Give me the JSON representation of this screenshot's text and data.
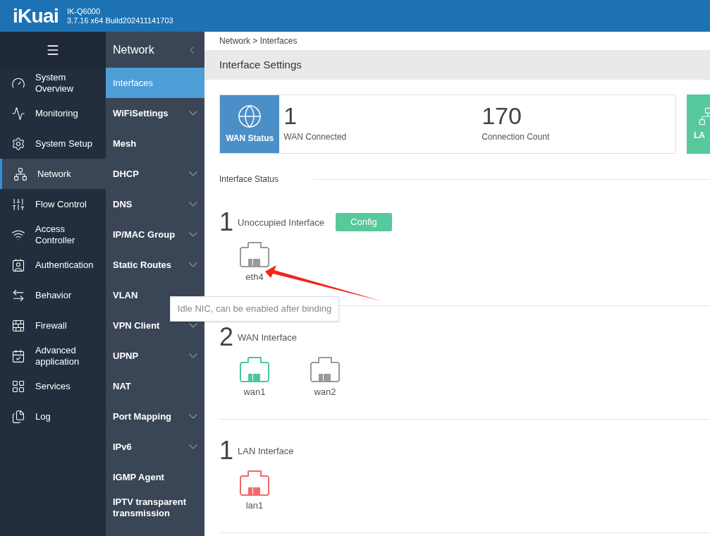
{
  "header": {
    "logo": "iKuai",
    "model": "IK-Q6000",
    "build": "3.7.16 x64 Build202411141703"
  },
  "main_nav": [
    {
      "label": "System Overview",
      "selected": false
    },
    {
      "label": "Monitoring",
      "selected": false
    },
    {
      "label": "System Setup",
      "selected": false
    },
    {
      "label": "Network",
      "selected": true
    },
    {
      "label": "Flow Control",
      "selected": false
    },
    {
      "label": "Access Controller",
      "selected": false
    },
    {
      "label": "Authentication",
      "selected": false
    },
    {
      "label": "Behavior",
      "selected": false
    },
    {
      "label": "Firewall",
      "selected": false
    },
    {
      "label": "Advanced application",
      "selected": false
    },
    {
      "label": "Services",
      "selected": false
    },
    {
      "label": "Log",
      "selected": false
    }
  ],
  "sub_nav": {
    "title": "Network",
    "items": [
      {
        "label": "Interfaces",
        "selected": true,
        "expandable": false
      },
      {
        "label": "WiFiSettings",
        "selected": false,
        "expandable": true
      },
      {
        "label": "Mesh",
        "selected": false,
        "expandable": false
      },
      {
        "label": "DHCP",
        "selected": false,
        "expandable": true
      },
      {
        "label": "DNS",
        "selected": false,
        "expandable": true
      },
      {
        "label": "IP/MAC Group",
        "selected": false,
        "expandable": true
      },
      {
        "label": "Static Routes",
        "selected": false,
        "expandable": true
      },
      {
        "label": "VLAN",
        "selected": false,
        "expandable": false
      },
      {
        "label": "VPN Client",
        "selected": false,
        "expandable": true
      },
      {
        "label": "UPNP",
        "selected": false,
        "expandable": true
      },
      {
        "label": "NAT",
        "selected": false,
        "expandable": false
      },
      {
        "label": "Port Mapping",
        "selected": false,
        "expandable": true
      },
      {
        "label": "IPv6",
        "selected": false,
        "expandable": true
      },
      {
        "label": "IGMP Agent",
        "selected": false,
        "expandable": false
      },
      {
        "label": "IPTV transparent transmission",
        "selected": false,
        "expandable": false
      }
    ]
  },
  "breadcrumb": "Network > Interfaces",
  "page_title": "Interface Settings",
  "wan_card": {
    "label": "WAN Status",
    "stats": [
      {
        "value": "1",
        "label": "WAN Connected"
      },
      {
        "value": "170",
        "label": "Connection Count"
      }
    ]
  },
  "lan_card": {
    "label": "LA"
  },
  "interface_status": {
    "title": "Interface Status",
    "groups": [
      {
        "count": "1",
        "label": "Unoccupied Interface",
        "button": "Config",
        "ports": [
          {
            "name": "eth4",
            "color": "#9a9a9a"
          }
        ]
      },
      {
        "count": "2",
        "label": "WAN Interface",
        "ports": [
          {
            "name": "wan1",
            "color": "#4cc79b"
          },
          {
            "name": "wan2",
            "color": "#9a9a9a"
          }
        ]
      },
      {
        "count": "1",
        "label": "LAN Interface",
        "ports": [
          {
            "name": "lan1",
            "color": "#f06a6a"
          }
        ]
      }
    ]
  },
  "tooltip": "Idle NIC, can be enabled after binding"
}
